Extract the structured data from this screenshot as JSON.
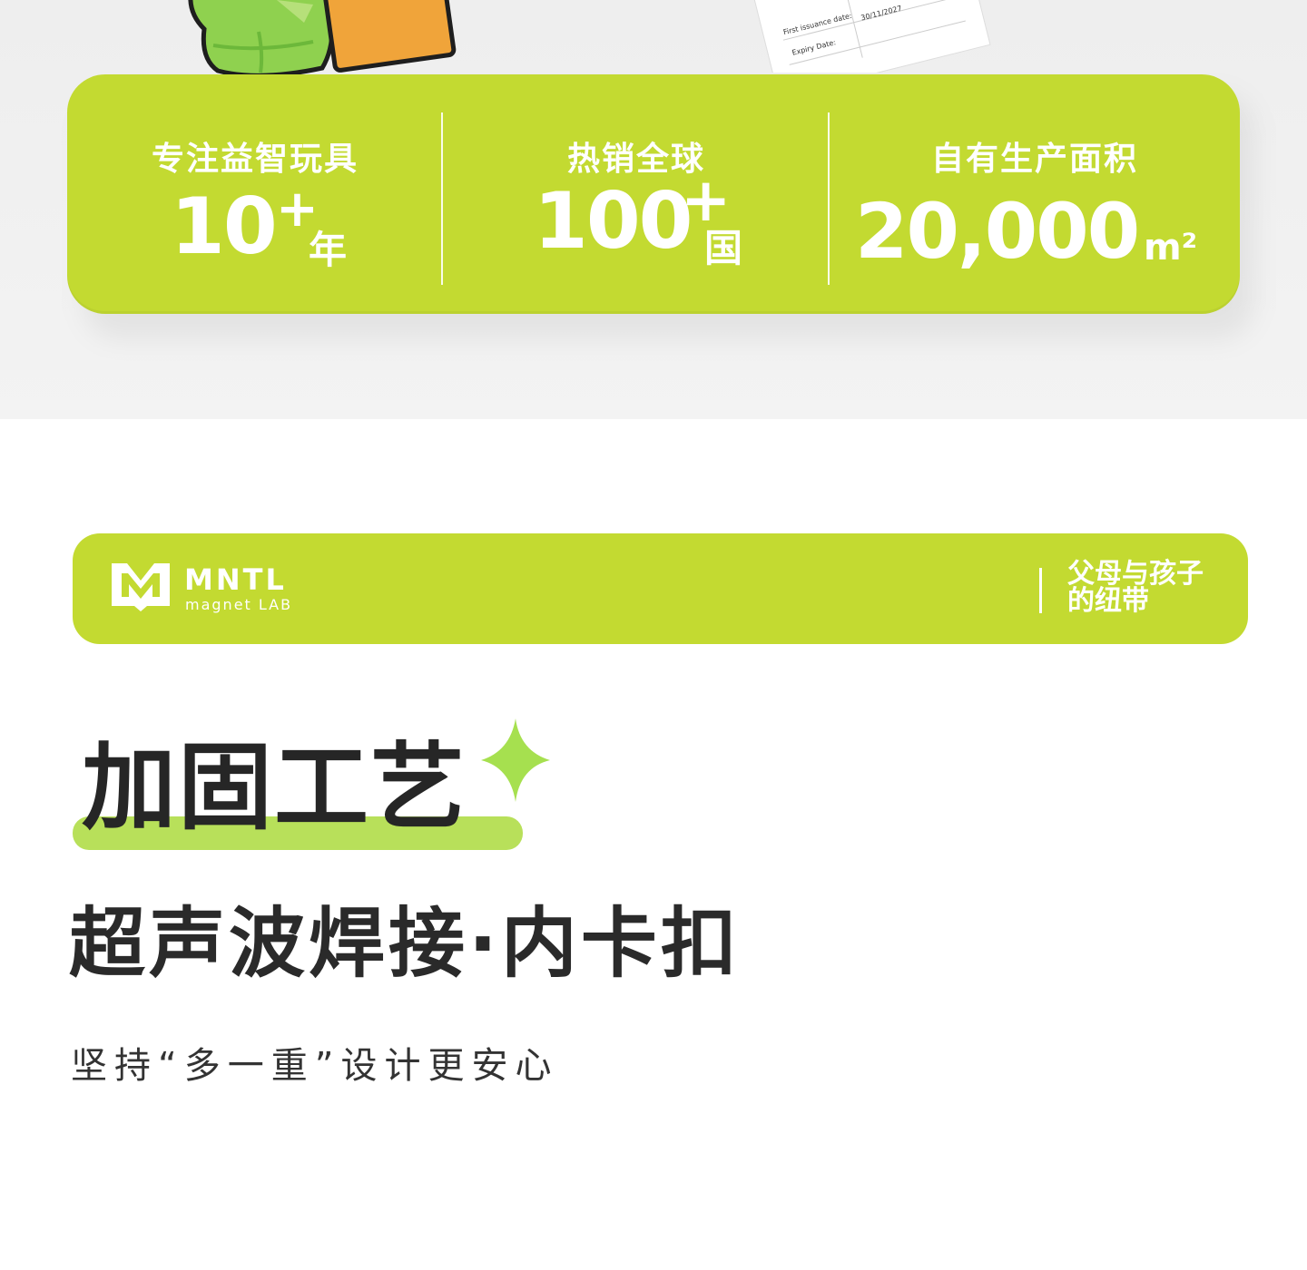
{
  "stats": [
    {
      "label": "专注益智玩具",
      "value": "10",
      "sup": "+",
      "unit": "年"
    },
    {
      "label": "热销全球",
      "value": "100",
      "sup": "+",
      "unit": "国"
    },
    {
      "label": "自有生产面积",
      "value": "20,000",
      "sup": "",
      "unit": "m²"
    }
  ],
  "certificate": {
    "lines": [
      "First issuance date:",
      "30/11/2027",
      "Expiry Date:"
    ]
  },
  "brand": {
    "logo_text": "MNTL",
    "logo_sub": "magnet LAB",
    "slogan_line1": "父母与孩子",
    "slogan_line2": "的纽带"
  },
  "section": {
    "title": "加固工艺",
    "subtitle": "超声波焊接·内卡扣",
    "description": "坚持“多一重”设计更安心"
  },
  "colors": {
    "accent": "#c3da31",
    "highlight": "#b8e05a",
    "text_dark": "#262626"
  }
}
